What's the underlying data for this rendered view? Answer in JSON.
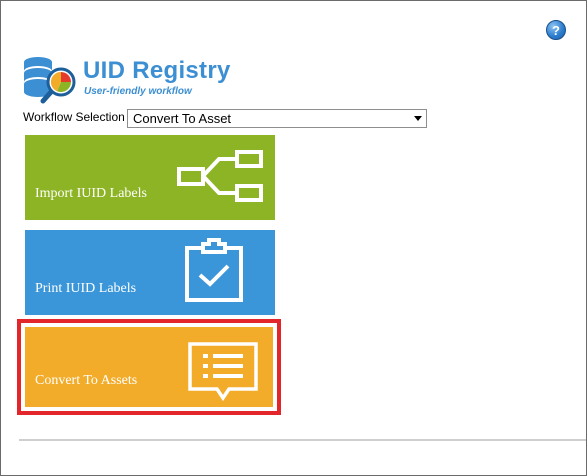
{
  "app": {
    "title": "UID Registry",
    "subtitle": "User-friendly workflow"
  },
  "help": {
    "label": "?"
  },
  "workflow": {
    "label": "Workflow Selection",
    "selected": "Convert To Asset"
  },
  "tiles": [
    {
      "label": "Import IUID Labels",
      "color": "#8cb424",
      "icon": "network-flow-icon"
    },
    {
      "label": "Print IUID Labels",
      "color": "#3a96d8",
      "icon": "clipboard-check-icon"
    },
    {
      "label": "Convert To Assets",
      "color": "#f2ac2a",
      "icon": "list-callout-icon",
      "highlighted": true
    }
  ],
  "colors": {
    "accent": "#3c8fd2",
    "highlight_border": "#e2262c"
  }
}
